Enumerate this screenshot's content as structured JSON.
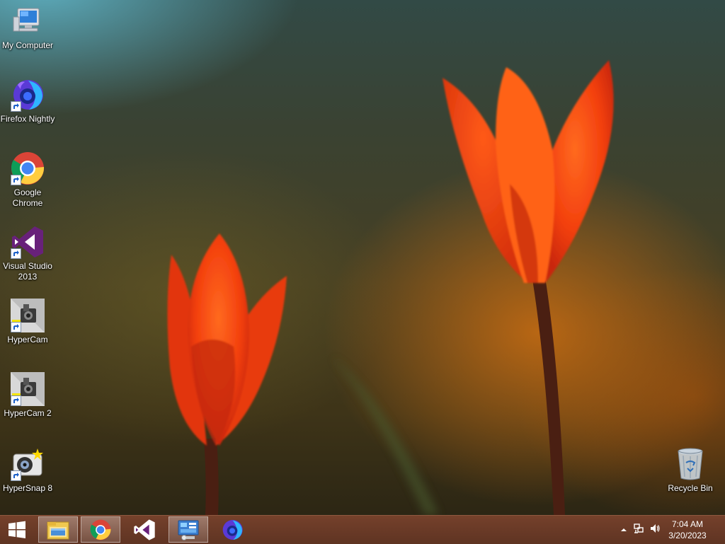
{
  "desktop_icons": [
    {
      "name": "my-computer",
      "label": "My Computer",
      "icon": "computer-icon"
    },
    {
      "name": "firefox-nightly",
      "label": "Firefox Nightly",
      "icon": "firefox-nightly-icon"
    },
    {
      "name": "google-chrome",
      "label": "Google Chrome",
      "icon": "chrome-icon"
    },
    {
      "name": "visual-studio-2013",
      "label": "Visual Studio 2013",
      "icon": "visual-studio-icon"
    },
    {
      "name": "hypercam",
      "label": "HyperCam",
      "icon": "hypercam-icon"
    },
    {
      "name": "hypercam-2",
      "label": "HyperCam 2",
      "icon": "hypercam-icon"
    },
    {
      "name": "hypersnap-8",
      "label": "HyperSnap 8",
      "icon": "hypersnap-icon"
    }
  ],
  "recycle_bin": {
    "label": "Recycle Bin",
    "icon": "recycle-bin-icon"
  },
  "taskbar": {
    "start_icon": "windows-logo-icon",
    "pinned": [
      {
        "name": "file-explorer",
        "icon": "folder-icon",
        "active": true
      },
      {
        "name": "google-chrome",
        "icon": "chrome-icon",
        "active": true
      },
      {
        "name": "visual-studio",
        "icon": "visual-studio-icon",
        "active": false
      },
      {
        "name": "control-panel",
        "icon": "control-panel-icon",
        "active": true
      },
      {
        "name": "firefox-nightly",
        "icon": "firefox-nightly-icon",
        "active": false
      }
    ],
    "tray_icons": [
      "chevron-up-icon",
      "network-icon",
      "volume-icon"
    ],
    "clock": {
      "time": "7:04 AM",
      "date": "3/20/2023"
    }
  },
  "colors": {
    "taskbar": "#7a4430",
    "tulip": "#ff4a10",
    "vs_purple": "#68217a"
  }
}
